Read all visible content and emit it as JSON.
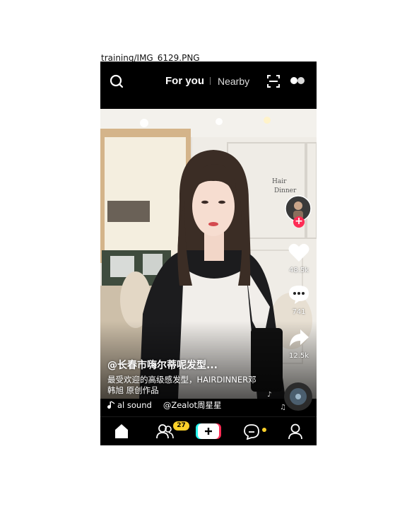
{
  "caption": "training/IMG_6129.PNG",
  "top_bar": {
    "tab_for_you": "For you",
    "tab_nearby": "Nearby",
    "icons": [
      "search-icon",
      "scan-icon",
      "more-dots-icon"
    ]
  },
  "video": {
    "sign_line1": "Hair",
    "sign_line2": "Dinner"
  },
  "rail": {
    "like_count": "48.5k",
    "comment_count": "741",
    "share_count": "12.5k",
    "follow_symbol": "+"
  },
  "post": {
    "username": "@长春市嗨尔蒂呢发型...",
    "description_line1": "最受欢迎的高级感发型，HAIRDINNER邓",
    "description_line2": "韩旭 原创作品",
    "sound_part1": "al sound",
    "sound_part2": "@Zealot周星星"
  },
  "bottom_nav": {
    "friends_badge": "27",
    "icons": [
      "home-icon",
      "friends-icon",
      "create-icon",
      "inbox-icon",
      "profile-icon"
    ]
  },
  "colors": {
    "accent_red": "#fe2c55",
    "badge_yellow": "#fcd12a",
    "create_cyan": "#25f4ee"
  }
}
